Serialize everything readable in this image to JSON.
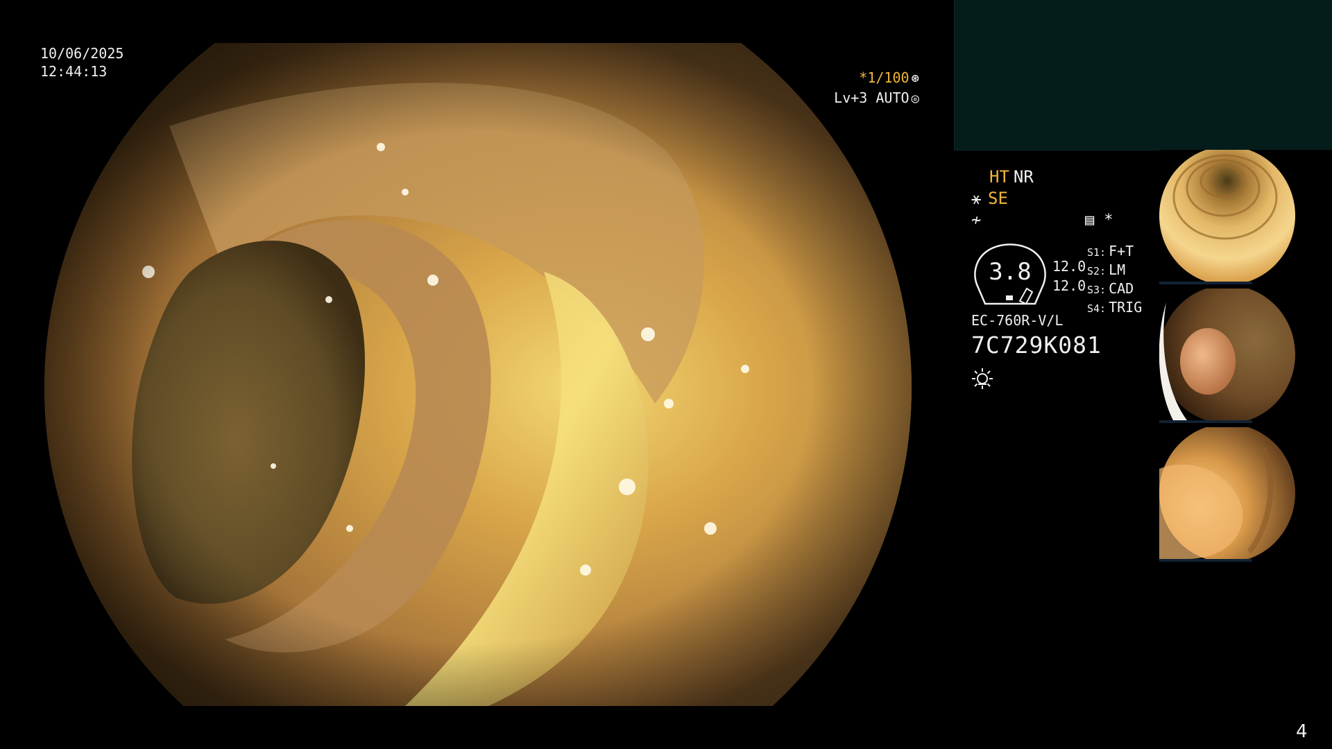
{
  "header": {
    "date": "10/06/2025",
    "time": "12:44:13"
  },
  "overlay": {
    "shutter": "*1/100",
    "shutter_icon": "aperture-icon",
    "level": "Lv+3 AUTO",
    "level_icon": "iris-icon"
  },
  "status": {
    "ht": "HT",
    "nr": "NR",
    "se": "SE",
    "se_icon": "structure-enhance-icon",
    "freeze_icon": "freeze-icon"
  },
  "tools": {
    "record_icon": "recording-icon",
    "asterisk": "*"
  },
  "gauge": {
    "value": "3.8"
  },
  "zoom": {
    "value_1": "12.0",
    "value_2": "12.0"
  },
  "memory": [
    {
      "key": "S1:",
      "value": "F+T"
    },
    {
      "key": "S2:",
      "value": "LM"
    },
    {
      "key": "S3:",
      "value": "CAD"
    },
    {
      "key": "S4:",
      "value": "TRIG"
    }
  ],
  "scope": {
    "model": "EC-760R-V/L",
    "serial": "7C729K081"
  },
  "light_icon": "light-source-icon",
  "thumbnails": [
    {
      "name": "capture-1"
    },
    {
      "name": "capture-2"
    },
    {
      "name": "capture-3"
    }
  ],
  "page_number": "4",
  "colors": {
    "accent": "#f2b73a",
    "panel": "#041d1a",
    "text": "#f0f0f0"
  }
}
